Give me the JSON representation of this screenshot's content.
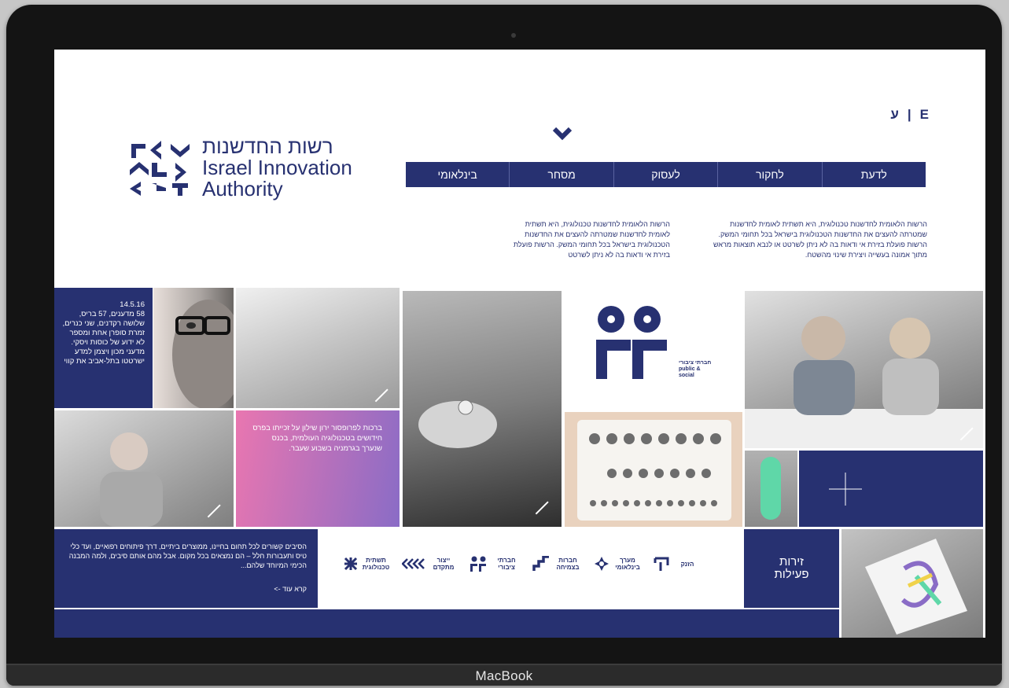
{
  "device": {
    "brand": "MacBook"
  },
  "header": {
    "language": {
      "hebrew": "ע",
      "english": "E",
      "separator": "|"
    },
    "logo": {
      "hebrew_name": "רשות החדשנות",
      "english_line1": "Israel Innovation",
      "english_line2": "Authority"
    }
  },
  "nav": {
    "items": [
      {
        "label": "לדעת"
      },
      {
        "label": "לחקור"
      },
      {
        "label": "לעסוק"
      },
      {
        "label": "מסחר"
      },
      {
        "label": "בינלאומי"
      }
    ]
  },
  "intro": {
    "right": "הרשות הלאומית לחדשנות טכנולוגית, היא תשתית לאומית לחדשנות שמטרתה להעצים את החדשנות הטכנולוגית בישראל בכל תחומי המשק. הרשות פועלת בזירת אי ודאות בה לא ניתן לשרטט או לנבא תוצאות מראש מתוך אמונה בעשייה ויצירת שינוי מהשטח.",
    "left": "הרשות הלאומית לחדשנות טכנולוגית, היא תשתית לאומית לחדשנות שמטרתה להעצים את החדשנות הטכנולוגית בישראל בכל תחומי המשק. הרשות פועלת בזירת אי ודאות בה לא ניתן לשרטט"
  },
  "tiles": {
    "news": {
      "date": "14.5.16",
      "text": "58 מדענים, 57 בריס, שלושה רקדנים, שני כנרים, זמרת סופרן אחת ומספר לא ידוע של כוסות ויסקי. מדעני מכון ויצמן למדע ישרטטו בתל-אביב את קווי"
    },
    "gradient": {
      "text": "ברכות לפרופסור ירון שילון על זכייתו בפרס חידושים בטכנולוגיה העולמית, בכנס שנערך בגרמניה בשבוע שעבר."
    },
    "public_logo": {
      "hebrew": "חברתי ציבורי",
      "english": "public & social"
    },
    "about": {
      "text": "הסיבים קשורים לכל תחום בחיינו, ממוצרים ביתיים, דרך פיתוחים רפואיים, ועד כלי טיס ותעבורות חלל – הם נמצאים בכל מקום. אבל מהם אותם סיבים, ולמה המבנה הכימי המיוחד שלהם...",
      "more": "קרא עוד ->"
    },
    "arenas": {
      "line1": "זירות",
      "line2": "פעילות"
    }
  },
  "activity_icons": [
    {
      "name": "infrastructure",
      "label": "תשתית טכנולוגית"
    },
    {
      "name": "advanced-manufacturing",
      "label": "ייצור מתקדם"
    },
    {
      "name": "public-social",
      "label": "חברתי ציבורי"
    },
    {
      "name": "growth",
      "label": "חברות בצמיחה"
    },
    {
      "name": "international",
      "label": "מערך בינלאומי"
    },
    {
      "name": "startup",
      "label": "הזנק"
    }
  ],
  "colors": {
    "primary": "#273171",
    "gradient_start": "#e976b0",
    "gradient_end": "#8a6cc6"
  }
}
